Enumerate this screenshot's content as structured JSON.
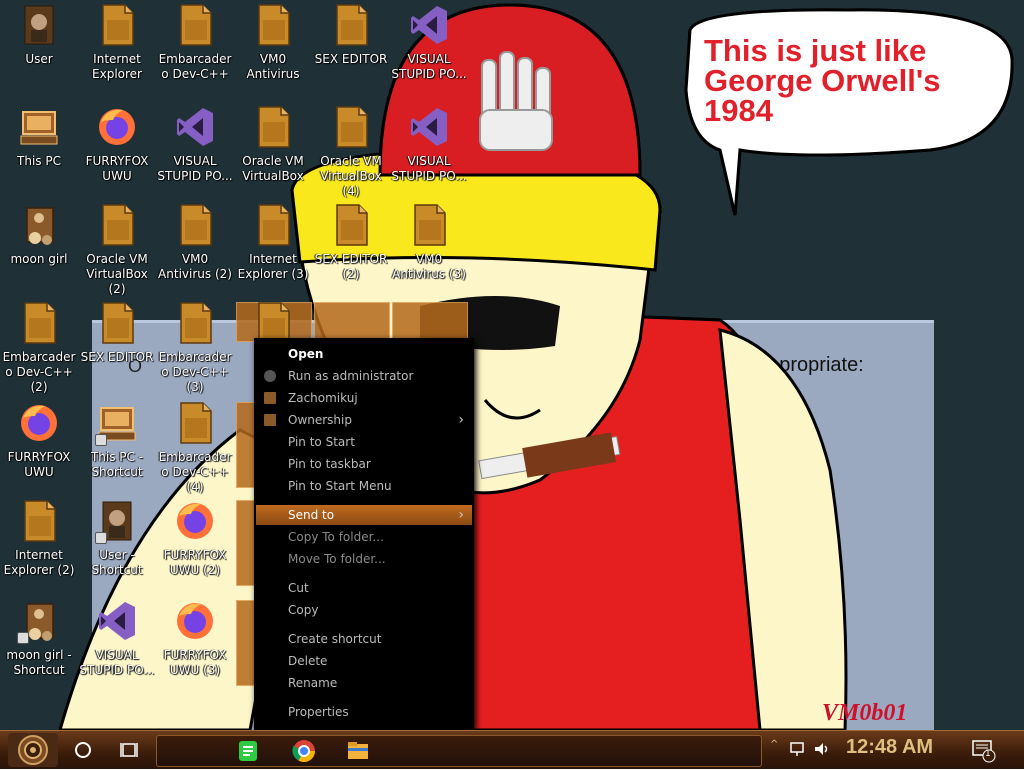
{
  "desktop_icons": [
    {
      "label": "User",
      "icon": "user-folder-icon",
      "col": 0,
      "row": 0
    },
    {
      "label": "Internet Explorer",
      "icon": "file-icon",
      "col": 1,
      "row": 0
    },
    {
      "label": "Embarcadero Dev-C++",
      "icon": "file-icon",
      "col": 2,
      "row": 0
    },
    {
      "label": "VM0 Antivirus",
      "icon": "file-icon",
      "col": 3,
      "row": 0
    },
    {
      "label": "SEX EDITOR",
      "icon": "file-icon",
      "col": 4,
      "row": 0
    },
    {
      "label": "VISUAL STUPID PO...",
      "icon": "visual-studio-icon",
      "col": 5,
      "row": 0
    },
    {
      "label": "This PC",
      "icon": "computer-icon",
      "col": 0,
      "row": 1
    },
    {
      "label": "FURRYFOX UWU",
      "icon": "firefox-icon",
      "col": 1,
      "row": 1
    },
    {
      "label": "VISUAL STUPID PO...",
      "icon": "visual-studio-icon",
      "col": 2,
      "row": 1
    },
    {
      "label": "Oracle VM VirtualBox",
      "icon": "file-icon",
      "col": 3,
      "row": 1
    },
    {
      "label": "Oracle VM VirtualBox (4)",
      "icon": "file-icon",
      "col": 4,
      "row": 1
    },
    {
      "label": "VISUAL STUPID PO...",
      "icon": "visual-studio-icon",
      "col": 5,
      "row": 1
    },
    {
      "label": "moon girl",
      "icon": "picture-icon",
      "col": 0,
      "row": 2
    },
    {
      "label": "Oracle VM VirtualBox (2)",
      "icon": "file-icon",
      "col": 1,
      "row": 2
    },
    {
      "label": "VM0 Antivirus (2)",
      "icon": "file-icon",
      "col": 2,
      "row": 2
    },
    {
      "label": "Internet Explorer (3)",
      "icon": "file-icon",
      "col": 3,
      "row": 2
    },
    {
      "label": "SEX EDITOR (2)",
      "icon": "file-icon",
      "col": 4,
      "row": 2
    },
    {
      "label": "VM0 Antivirus (3)",
      "icon": "file-icon",
      "col": 5,
      "row": 2
    },
    {
      "label": "Embarcadero Dev-C++ (2)",
      "icon": "file-icon",
      "col": 0,
      "row": 3
    },
    {
      "label": "SEX EDITOR",
      "icon": "file-icon",
      "col": 1,
      "row": 3
    },
    {
      "label": "Embarcadero Dev-C++ (3)",
      "icon": "file-icon",
      "col": 2,
      "row": 3
    },
    {
      "label": "Ex",
      "icon": "file-icon",
      "col": 3,
      "row": 3
    },
    {
      "label": "FURRYFOX UWU",
      "icon": "firefox-icon",
      "col": 0,
      "row": 4
    },
    {
      "label": "This PC - Shortcut",
      "icon": "computer-icon",
      "col": 1,
      "row": 4
    },
    {
      "label": "Embarcadero Dev-C++ (4)",
      "icon": "file-icon",
      "col": 2,
      "row": 4
    },
    {
      "label": "m Sh",
      "icon": "file-icon",
      "col": 3,
      "row": 4
    },
    {
      "label": "Internet Explorer (2)",
      "icon": "file-icon",
      "col": 0,
      "row": 5
    },
    {
      "label": "User - Shortcut",
      "icon": "user-folder-icon",
      "col": 1,
      "row": 5
    },
    {
      "label": "FURRYFOX UWU (2)",
      "icon": "firefox-icon",
      "col": 2,
      "row": 5
    },
    {
      "label": "m Sh",
      "icon": "file-icon",
      "col": 3,
      "row": 5
    },
    {
      "label": "moon girl - Shortcut",
      "icon": "picture-icon",
      "col": 0,
      "row": 6
    },
    {
      "label": "VISUAL STUPID PO...",
      "icon": "visual-studio-icon",
      "col": 1,
      "row": 6
    },
    {
      "label": "FURRYFOX UWU (3)",
      "icon": "firefox-icon",
      "col": 2,
      "row": 6
    },
    {
      "label": "O Virt",
      "icon": "file-icon",
      "col": 3,
      "row": 6
    }
  ],
  "speech_bubble": "This is just like George Orwell's 1984",
  "background_window": {
    "text_right": "s been deemed inappropriate:",
    "text_left": "O"
  },
  "watermark": "VM0b01",
  "context_menu": {
    "items": [
      {
        "label": "Open",
        "style": "bold"
      },
      {
        "label": "Run as administrator",
        "icon": "shield-icon"
      },
      {
        "label": "Zachomikuj",
        "icon": "app-icon"
      },
      {
        "label": "Ownership",
        "icon": "ownership-icon",
        "submenu": true
      },
      {
        "label": "Pin to Start"
      },
      {
        "label": "Pin to taskbar"
      },
      {
        "label": "Pin to Start Menu"
      },
      {
        "label": "Send to",
        "submenu": true,
        "style": "active"
      },
      {
        "label": "Copy To folder..."
      },
      {
        "label": "Move To folder..."
      },
      {
        "label": "Cut"
      },
      {
        "label": "Copy"
      },
      {
        "label": "Create shortcut"
      },
      {
        "label": "Delete"
      },
      {
        "label": "Rename"
      },
      {
        "label": "Properties"
      }
    ]
  },
  "taskbar": {
    "start_icon": "steampunk-start-icon",
    "search_icon": "cortana-circle-icon",
    "task_view_icon": "task-view-icon",
    "pinned": [
      {
        "name": "notes-app-icon",
        "color": "#2ecc40"
      },
      {
        "name": "chrome-icon",
        "color": "#db4437"
      },
      {
        "name": "file-explorer-icon",
        "color": "#f2b33d"
      }
    ],
    "tray": {
      "clock": "12:48 AM",
      "notification_count": "1"
    }
  },
  "colors": {
    "menu_bg": "#000000",
    "menu_active": "#b0601c",
    "taskbar_bg": "#3a1c0a",
    "speech_text": "#e0202a"
  }
}
